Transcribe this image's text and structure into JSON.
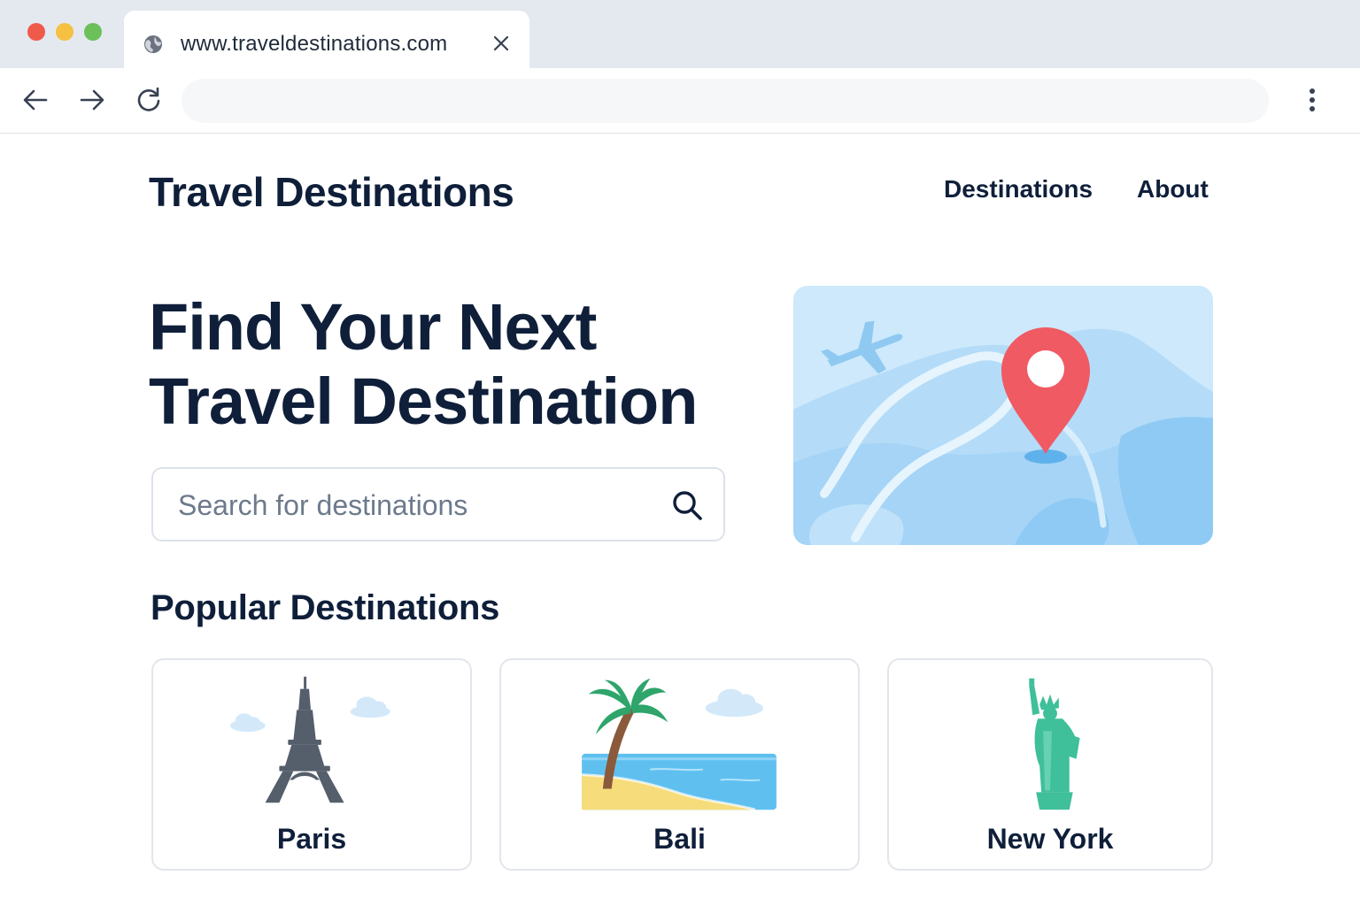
{
  "browser": {
    "tab_title": "www.traveldestinations.com",
    "address_value": "",
    "colors": {
      "close": "#f05a4b",
      "minimize": "#f6c042",
      "maximize": "#6cc05a"
    }
  },
  "site": {
    "brand": "Travel Destinations",
    "nav": [
      {
        "label": "Destinations"
      },
      {
        "label": "About"
      }
    ]
  },
  "hero": {
    "title_line1": "Find Your Next",
    "title_line2": "Travel Destination",
    "search_placeholder": "Search for destinations",
    "image": "map-with-location-pin-and-airplane"
  },
  "popular": {
    "title": "Popular Destinations",
    "cards": [
      {
        "label": "Paris",
        "icon": "eiffel-tower"
      },
      {
        "label": "Bali",
        "icon": "palm-beach"
      },
      {
        "label": "New York",
        "icon": "statue-of-liberty"
      }
    ]
  },
  "colors": {
    "text": "#0f1f3a",
    "map_bg": "#cde9fb",
    "pin": "#f05a63",
    "liberty": "#3fbf9a"
  }
}
